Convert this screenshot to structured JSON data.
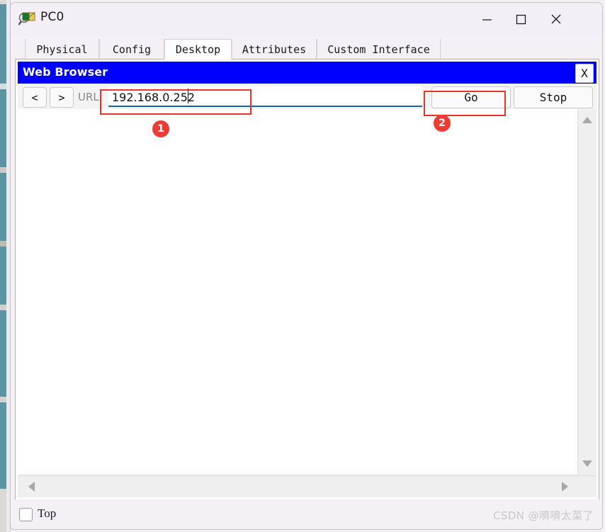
{
  "window": {
    "title": "PC0",
    "icon": "packet-tracer-pc-icon",
    "controls": {
      "minimize": "—",
      "maximize": "□",
      "close": "✕"
    }
  },
  "tabs": [
    {
      "label": "Physical",
      "active": false
    },
    {
      "label": "Config",
      "active": false
    },
    {
      "label": "Desktop",
      "active": true
    },
    {
      "label": "Attributes",
      "active": false
    },
    {
      "label": "Custom Interface",
      "active": false
    }
  ],
  "web_browser": {
    "title": "Web Browser",
    "close_label": "X",
    "toolbar": {
      "back_label": "<",
      "forward_label": ">",
      "url_label": "URL",
      "url_value": "192.168.0.252",
      "url_placeholder": "",
      "go_label": "Go",
      "stop_label": "Stop"
    },
    "page_content": "",
    "scrollbars": {
      "vertical_up": "scroll-up-arrow",
      "vertical_down": "scroll-down-arrow",
      "horizontal_left": "scroll-left-arrow",
      "horizontal_right": "scroll-right-arrow"
    }
  },
  "bottom_bar": {
    "top_checkbox_label": "Top",
    "top_checkbox_checked": false,
    "watermark": "CSDN @嚌嚌太菜了"
  },
  "annotations": [
    {
      "id": "1",
      "target": "url-input"
    },
    {
      "id": "2",
      "target": "go-button"
    }
  ],
  "colors": {
    "browser_titlebar": "#0000FF",
    "annotation_red": "#E8332A",
    "badge_red": "#EE3B33",
    "url_focus_underline": "#1565A8"
  }
}
